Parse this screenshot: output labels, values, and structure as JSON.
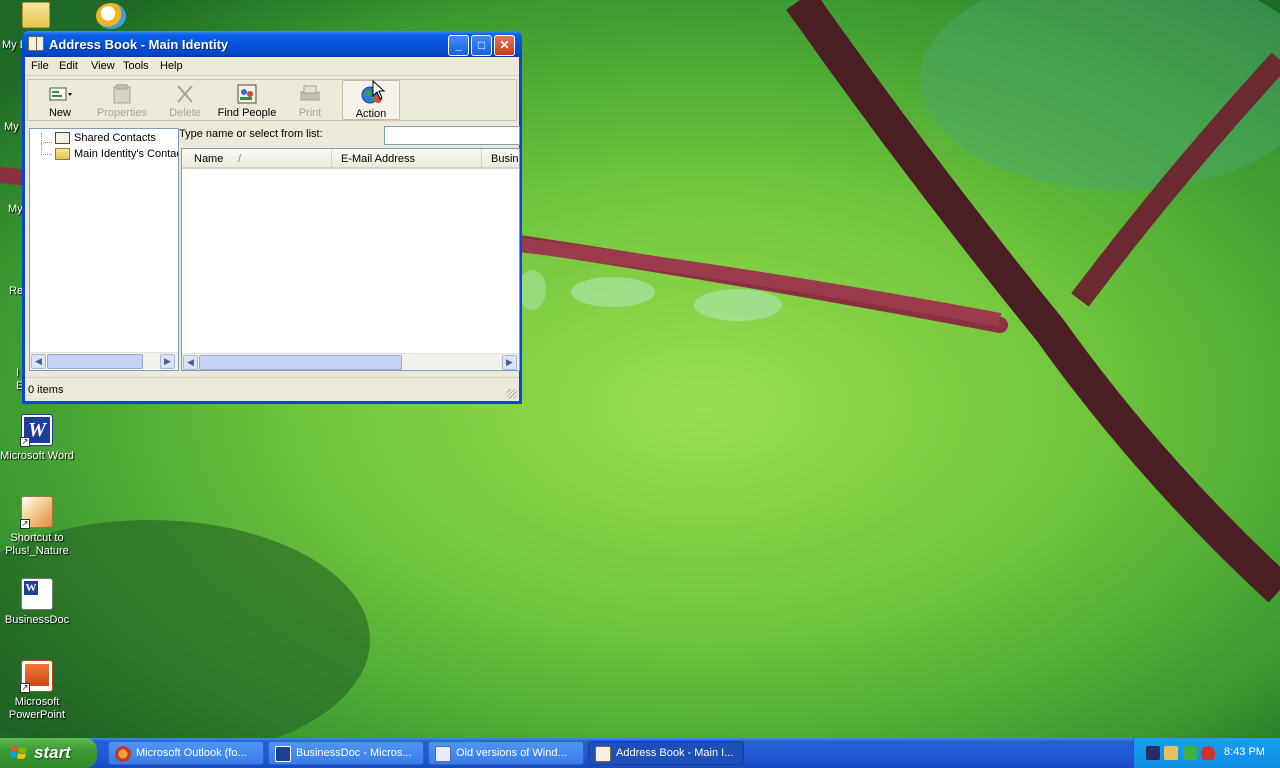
{
  "window": {
    "title": "Address Book - Main Identity",
    "menu": [
      "File",
      "Edit",
      "View",
      "Tools",
      "Help"
    ],
    "toolbar": {
      "new": "New",
      "properties": "Properties",
      "delete": "Delete",
      "find_people": "Find People",
      "print": "Print",
      "action": "Action"
    },
    "tree": {
      "items": [
        "Shared Contacts",
        "Main Identity's Contacts"
      ]
    },
    "search": {
      "label": "Type name or select from list:",
      "value": ""
    },
    "list": {
      "columns": [
        "Name",
        "E-Mail Address",
        "Business Phone"
      ],
      "sort_indicator": "/",
      "rows": []
    },
    "status": "0 items"
  },
  "desktop": {
    "icons": [
      {
        "label": "Microsoft Word",
        "icon": "word-icon"
      },
      {
        "label": "Shortcut to Plus!_Nature",
        "icon": "plus-nature-icon"
      },
      {
        "label": "BusinessDoc",
        "icon": "word-document-icon"
      },
      {
        "label": "Microsoft PowerPoint",
        "icon": "powerpoint-icon"
      }
    ],
    "partial_labels": [
      "My D",
      "My",
      "My",
      "Re",
      "I",
      "E"
    ]
  },
  "taskbar": {
    "start_label": "start",
    "tasks": [
      {
        "label": "Microsoft Outlook (fo...",
        "icon": "outlook-icon",
        "active": false
      },
      {
        "label": "BusinessDoc - Micros...",
        "icon": "word-icon",
        "active": false
      },
      {
        "label": "Old versions of Wind...",
        "icon": "document-icon",
        "active": false
      },
      {
        "label": "Address Book - Main I...",
        "icon": "address-book-icon",
        "active": true
      }
    ],
    "clock": "8:43 PM"
  },
  "colors": {
    "title_blue": "#0a5fe6",
    "taskbar_blue": "#245edb",
    "start_green": "#3c9c34",
    "window_face": "#ece9d8"
  }
}
